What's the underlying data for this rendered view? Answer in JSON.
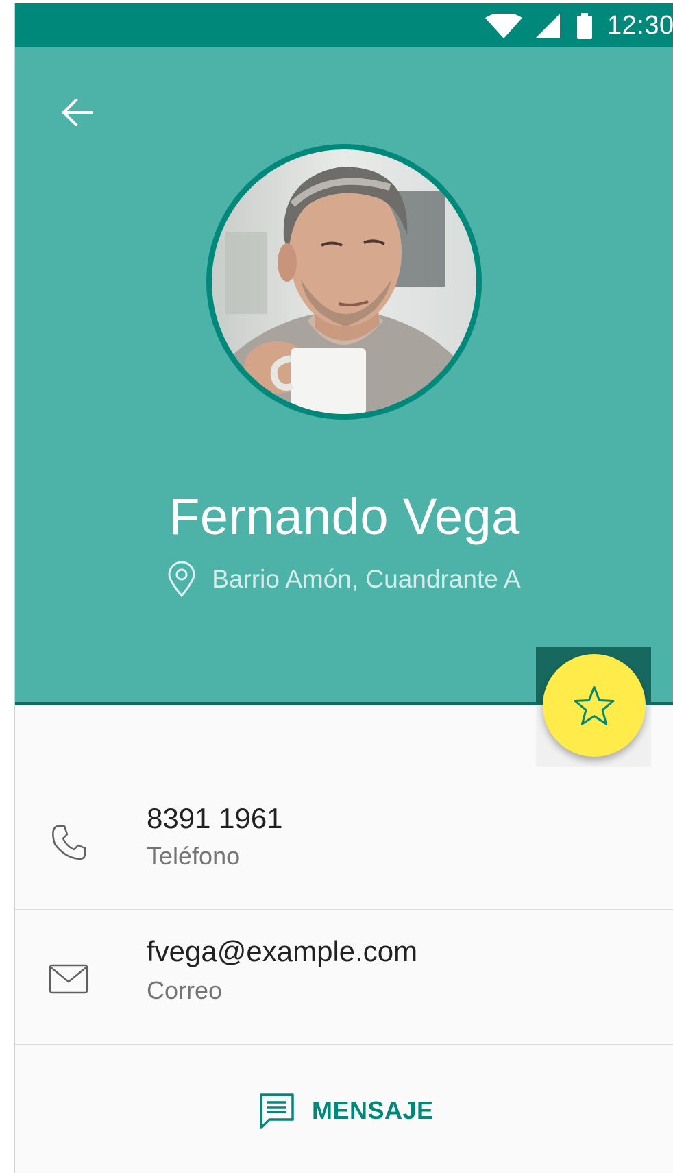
{
  "status_bar": {
    "time": "12:30",
    "icons": [
      "wifi-icon",
      "signal-icon",
      "battery-icon"
    ]
  },
  "header": {
    "back_icon": "arrow-back-icon",
    "name": "Fernando Vega",
    "location_icon": "location-pin-icon",
    "location": "Barrio Amón, Cuandrante A"
  },
  "fab": {
    "icon": "star-outline-icon"
  },
  "contact_rows": [
    {
      "icon": "phone-icon",
      "value": "8391 1961",
      "label": "Teléfono"
    },
    {
      "icon": "mail-icon",
      "value": "fvega@example.com",
      "label": "Correo"
    }
  ],
  "action": {
    "icon": "message-icon",
    "label": "MENSAJE"
  },
  "colors": {
    "status_bar": "#00897b",
    "header": "#4db2a8",
    "accent": "#00897b",
    "fab": "#ffeb4a"
  }
}
